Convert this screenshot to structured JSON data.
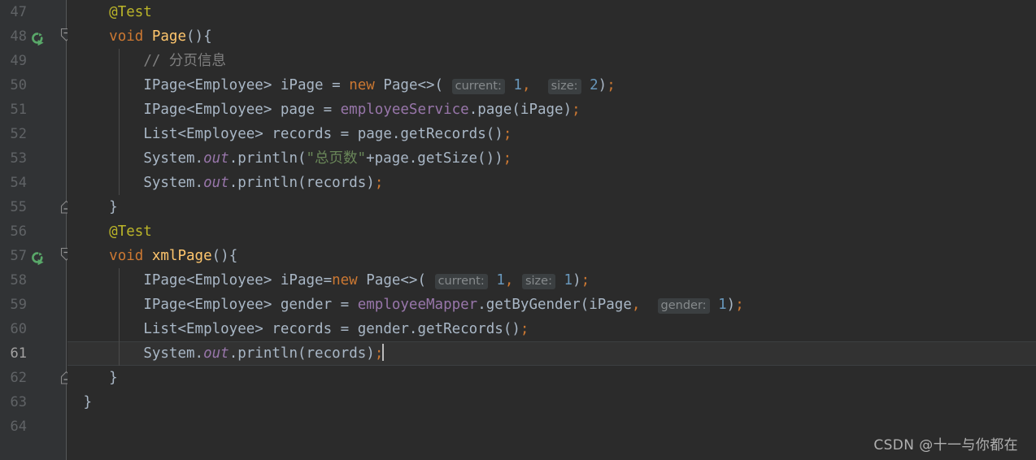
{
  "editor": {
    "theme": "darcula",
    "background": "#2b2b2b",
    "gutter_background": "#313335",
    "current_line_background": "#323232",
    "first_visible_line": 47,
    "last_visible_line": 64,
    "caret_line": 61,
    "colors": {
      "annotation": "#bbb529",
      "keyword": "#cc7832",
      "method_declaration": "#ffc66d",
      "default_text": "#a9b7c6",
      "field": "#9876aa",
      "number": "#6897bb",
      "string": "#6a8759",
      "comment": "#808080",
      "line_number": "#606366",
      "line_number_current": "#a4a3a3",
      "hint_background": "#3b3f41",
      "hint_text": "#868a8c",
      "run_icon_green": "#59a869"
    }
  },
  "lines": [
    {
      "num": "47",
      "indent": 4,
      "gutter_icon": null,
      "fold": null,
      "current": false,
      "tokens": [
        {
          "text": "@Test",
          "kind": "anno"
        }
      ]
    },
    {
      "num": "48",
      "indent": 4,
      "gutter_icon": "run-test-icon",
      "fold": "expanded-start",
      "current": false,
      "tokens": [
        {
          "text": "void",
          "kind": "kw"
        },
        {
          "text": " ",
          "kind": "default"
        },
        {
          "text": "Page",
          "kind": "method"
        },
        {
          "text": "(){",
          "kind": "default"
        }
      ]
    },
    {
      "num": "49",
      "indent": 8,
      "gutter_icon": null,
      "fold": null,
      "current": false,
      "tokens": [
        {
          "text": "// 分页信息",
          "kind": "comment"
        }
      ]
    },
    {
      "num": "50",
      "indent": 8,
      "gutter_icon": null,
      "fold": null,
      "current": false,
      "tokens": [
        {
          "text": "IPage<Employee> iPage = ",
          "kind": "default"
        },
        {
          "text": "new",
          "kind": "kw"
        },
        {
          "text": " Page<>(",
          "kind": "default"
        },
        {
          "text": " ",
          "kind": "default"
        },
        {
          "text": "current:",
          "kind": "hint"
        },
        {
          "text": " ",
          "kind": "default"
        },
        {
          "text": "1",
          "kind": "num"
        },
        {
          "text": ",",
          "kind": "semi"
        },
        {
          "text": "  ",
          "kind": "default"
        },
        {
          "text": "size:",
          "kind": "hint"
        },
        {
          "text": " ",
          "kind": "default"
        },
        {
          "text": "2",
          "kind": "num"
        },
        {
          "text": ")",
          "kind": "default"
        },
        {
          "text": ";",
          "kind": "semi"
        }
      ]
    },
    {
      "num": "51",
      "indent": 8,
      "gutter_icon": null,
      "fold": null,
      "current": false,
      "tokens": [
        {
          "text": "IPage<Employee> page = ",
          "kind": "default"
        },
        {
          "text": "employeeService",
          "kind": "field"
        },
        {
          "text": ".page(iPage)",
          "kind": "default"
        },
        {
          "text": ";",
          "kind": "semi"
        }
      ]
    },
    {
      "num": "52",
      "indent": 8,
      "gutter_icon": null,
      "fold": null,
      "current": false,
      "tokens": [
        {
          "text": "List<Employee> records = page.getRecords()",
          "kind": "default"
        },
        {
          "text": ";",
          "kind": "semi"
        }
      ]
    },
    {
      "num": "53",
      "indent": 8,
      "gutter_icon": null,
      "fold": null,
      "current": false,
      "tokens": [
        {
          "text": "System.",
          "kind": "default"
        },
        {
          "text": "out",
          "kind": "static"
        },
        {
          "text": ".println(",
          "kind": "default"
        },
        {
          "text": "\"总页数\"",
          "kind": "str"
        },
        {
          "text": "+page.getSize())",
          "kind": "default"
        },
        {
          "text": ";",
          "kind": "semi"
        }
      ]
    },
    {
      "num": "54",
      "indent": 8,
      "gutter_icon": null,
      "fold": null,
      "current": false,
      "tokens": [
        {
          "text": "System.",
          "kind": "default"
        },
        {
          "text": "out",
          "kind": "static"
        },
        {
          "text": ".println(records)",
          "kind": "default"
        },
        {
          "text": ";",
          "kind": "semi"
        }
      ]
    },
    {
      "num": "55",
      "indent": 4,
      "gutter_icon": null,
      "fold": "expanded-end",
      "current": false,
      "tokens": [
        {
          "text": "}",
          "kind": "default"
        }
      ]
    },
    {
      "num": "56",
      "indent": 4,
      "gutter_icon": null,
      "fold": null,
      "current": false,
      "tokens": [
        {
          "text": "@Test",
          "kind": "anno"
        }
      ]
    },
    {
      "num": "57",
      "indent": 4,
      "gutter_icon": "run-test-icon",
      "fold": "expanded-start",
      "current": false,
      "tokens": [
        {
          "text": "void",
          "kind": "kw"
        },
        {
          "text": " ",
          "kind": "default"
        },
        {
          "text": "xmlPage",
          "kind": "method"
        },
        {
          "text": "(){",
          "kind": "default"
        }
      ]
    },
    {
      "num": "58",
      "indent": 8,
      "gutter_icon": null,
      "fold": null,
      "current": false,
      "tokens": [
        {
          "text": "IPage<Employee> iPage=",
          "kind": "default"
        },
        {
          "text": "new",
          "kind": "kw"
        },
        {
          "text": " Page<>(",
          "kind": "default"
        },
        {
          "text": " ",
          "kind": "default"
        },
        {
          "text": "current:",
          "kind": "hint"
        },
        {
          "text": " ",
          "kind": "default"
        },
        {
          "text": "1",
          "kind": "num"
        },
        {
          "text": ",",
          "kind": "semi"
        },
        {
          "text": " ",
          "kind": "default"
        },
        {
          "text": "size:",
          "kind": "hint"
        },
        {
          "text": " ",
          "kind": "default"
        },
        {
          "text": "1",
          "kind": "num"
        },
        {
          "text": ")",
          "kind": "default"
        },
        {
          "text": ";",
          "kind": "semi"
        }
      ]
    },
    {
      "num": "59",
      "indent": 8,
      "gutter_icon": null,
      "fold": null,
      "current": false,
      "tokens": [
        {
          "text": "IPage<Employee> gender = ",
          "kind": "default"
        },
        {
          "text": "employeeMapper",
          "kind": "field"
        },
        {
          "text": ".getByGender(iPage",
          "kind": "default"
        },
        {
          "text": ",",
          "kind": "semi"
        },
        {
          "text": "  ",
          "kind": "default"
        },
        {
          "text": "gender:",
          "kind": "hint"
        },
        {
          "text": " ",
          "kind": "default"
        },
        {
          "text": "1",
          "kind": "num"
        },
        {
          "text": ")",
          "kind": "default"
        },
        {
          "text": ";",
          "kind": "semi"
        }
      ]
    },
    {
      "num": "60",
      "indent": 8,
      "gutter_icon": null,
      "fold": null,
      "current": false,
      "tokens": [
        {
          "text": "List<Employee> records = gender.getRecords()",
          "kind": "default"
        },
        {
          "text": ";",
          "kind": "semi"
        }
      ]
    },
    {
      "num": "61",
      "indent": 8,
      "gutter_icon": null,
      "fold": null,
      "current": true,
      "caret_after": true,
      "tokens": [
        {
          "text": "System.",
          "kind": "default"
        },
        {
          "text": "out",
          "kind": "static"
        },
        {
          "text": ".println(records)",
          "kind": "default"
        },
        {
          "text": ";",
          "kind": "semi"
        }
      ]
    },
    {
      "num": "62",
      "indent": 4,
      "gutter_icon": null,
      "fold": "expanded-end",
      "current": false,
      "tokens": [
        {
          "text": "}",
          "kind": "default"
        }
      ]
    },
    {
      "num": "63",
      "indent": 1,
      "gutter_icon": null,
      "fold": null,
      "current": false,
      "tokens": [
        {
          "text": "}",
          "kind": "default"
        }
      ]
    },
    {
      "num": "64",
      "indent": 0,
      "gutter_icon": null,
      "fold": null,
      "current": false,
      "tokens": []
    }
  ],
  "indent_guides": [
    {
      "from_line": 49,
      "to_line": 54
    },
    {
      "from_line": 58,
      "to_line": 61
    }
  ],
  "watermark": {
    "text": "CSDN @十一与你都在"
  }
}
